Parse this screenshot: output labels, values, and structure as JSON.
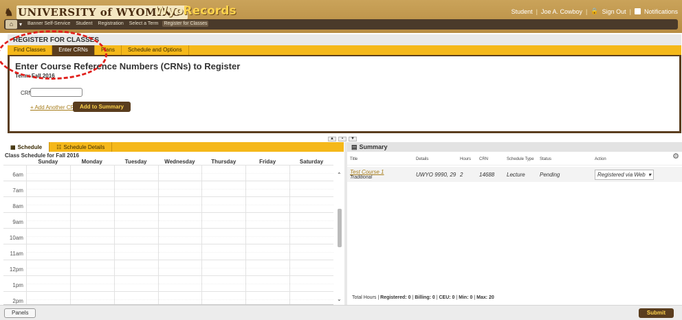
{
  "header": {
    "logo_text": "UNIVERSITY of WYOMING",
    "app_name_prefix": "Wyo",
    "app_name_suffix": "Records",
    "user_role": "Student",
    "user_name": "Joe A. Cowboy",
    "sign_out": "Sign Out",
    "notifications": "Notifications"
  },
  "breadcrumb": {
    "items": [
      "Banner Self-Service",
      "Student",
      "Registration",
      "Select a Term",
      "Register for Classes"
    ]
  },
  "register": {
    "title": "REGISTER FOR CLASSES",
    "tabs": [
      "Find Classes",
      "Enter CRNs",
      "Plans",
      "Schedule and Options"
    ],
    "active_tab": "Enter CRNs",
    "panel_title": "Enter Course Reference Numbers (CRNs) to Register",
    "term": "Term: Fall 2016",
    "crn_label": "CRN",
    "crn_value": "",
    "add_crn": "+ Add Another CRN",
    "add_summary": "Add to Summary"
  },
  "schedule": {
    "tabs": [
      "Schedule",
      "Schedule Details"
    ],
    "title": "Class Schedule for Fall 2016",
    "days": [
      "Sunday",
      "Monday",
      "Tuesday",
      "Wednesday",
      "Thursday",
      "Friday",
      "Saturday"
    ],
    "times": [
      "6am",
      "7am",
      "8am",
      "9am",
      "10am",
      "11am",
      "12pm",
      "1pm",
      "2pm"
    ]
  },
  "summary": {
    "title": "Summary",
    "columns": [
      "Title",
      "Details",
      "Hours",
      "CRN",
      "Schedule Type",
      "Status",
      "Action"
    ],
    "rows": [
      {
        "title": "Test Course 1",
        "subtitle": "Traditional",
        "details": "UWYO 9990, 29",
        "hours": "2",
        "crn": "14688",
        "schedule_type": "Lecture",
        "status": "Pending",
        "action": "Registered via Web"
      }
    ],
    "totals": {
      "label": "Total Hours",
      "registered": "Registered: 0",
      "billing": "Billing: 0",
      "ceu": "CEU: 0",
      "min": "Min: 0",
      "max": "Max: 20"
    }
  },
  "footer": {
    "panels": "Panels",
    "submit": "Submit"
  },
  "colors": {
    "brown": "#5a3d1e",
    "gold": "#f5b81a",
    "annotation_red": "#e0201c"
  }
}
